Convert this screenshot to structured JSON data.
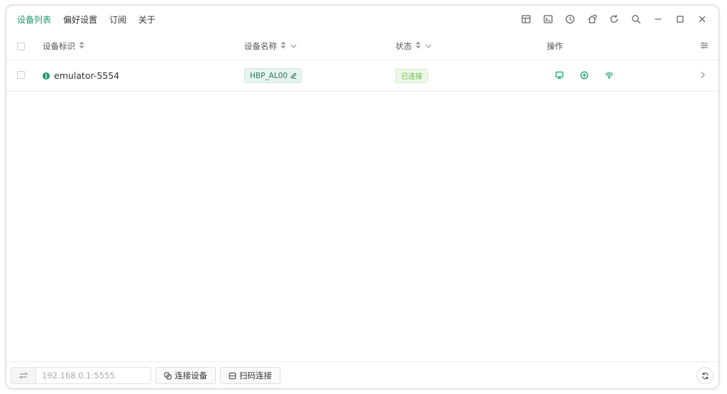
{
  "nav": {
    "tabs": [
      {
        "label": "设备列表",
        "active": true
      },
      {
        "label": "偏好设置",
        "active": false
      },
      {
        "label": "订阅",
        "active": false
      },
      {
        "label": "关于",
        "active": false
      }
    ]
  },
  "toolbar": {
    "icons": [
      "layout-icon",
      "terminal-icon",
      "clock-icon",
      "share-icon",
      "refresh-icon",
      "search-icon",
      "minimize-icon",
      "maximize-icon",
      "close-icon"
    ]
  },
  "table": {
    "columns": {
      "serial": "设备标识",
      "name": "设备名称",
      "status": "状态",
      "actions": "操作"
    },
    "rows": [
      {
        "serial": "emulator-5554",
        "name": "HBP_AL00",
        "status": "已连接"
      }
    ]
  },
  "bottom": {
    "ip_placeholder": "192.168.0.1:5555",
    "connect_label": "连接设备",
    "scan_label": "扫码连接"
  },
  "colors": {
    "accent": "#1a9a6c",
    "status_text": "#67b84a",
    "action_icon": "#1fa56f"
  }
}
